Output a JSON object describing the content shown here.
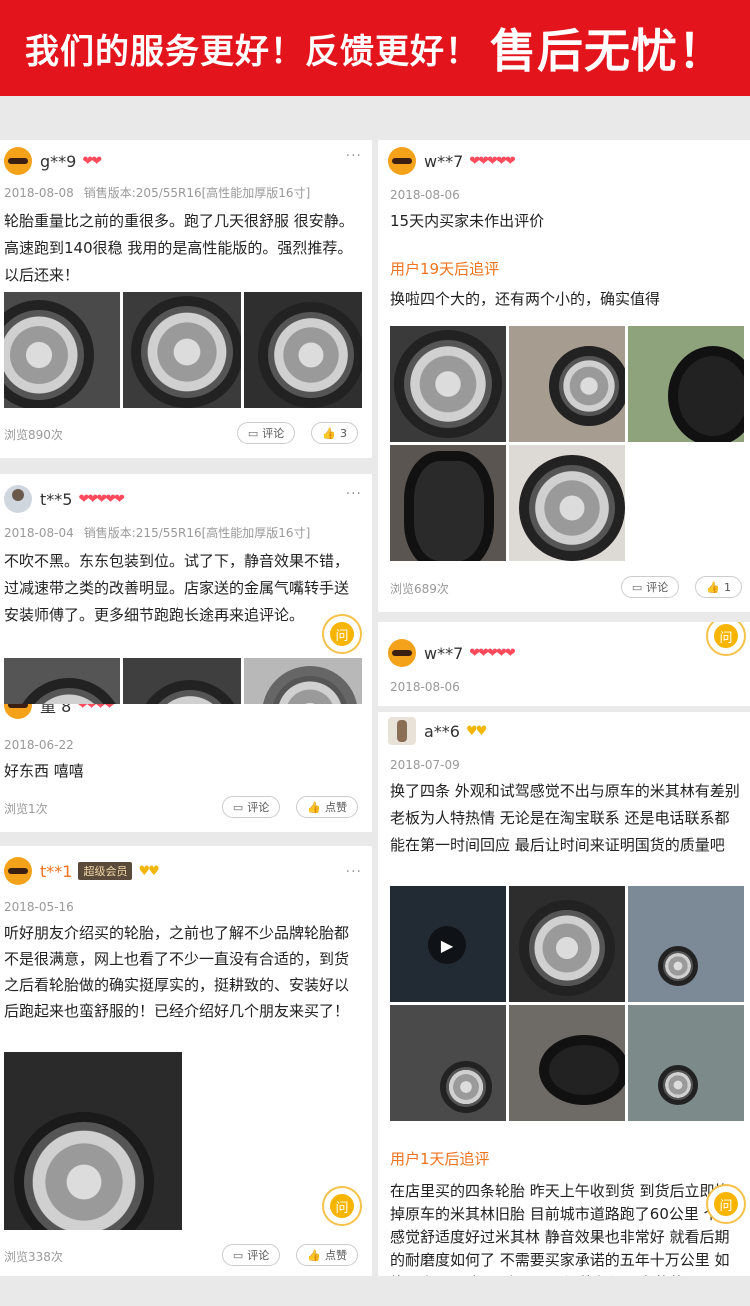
{
  "banner": {
    "text": "我们的服务更好！反馈更好！",
    "emphasis": "售后无忧！"
  },
  "reviews": [
    {
      "user": "g**9",
      "hearts": "❤❤",
      "date": "2018-08-08",
      "version": "销售版本:205/55R16[高性能加厚版16寸]",
      "text": "轮胎重量比之前的重很多。跑了几天很舒服 很安静。高速跑到140很稳 我用的是高性能版的。强烈推荐。以后还来！",
      "views": "浏览890次",
      "comment": "评论",
      "likes": "3"
    },
    {
      "user": "t**5",
      "hearts": "❤❤❤❤❤",
      "date": "2018-08-04",
      "version": "销售版本:215/55R16[高性能加厚版16寸]",
      "text": "不吹不黑。东东包装到位。试了下，静音效果不错，过减速带之类的改善明显。店家送的金属气嘴转手送安装师傅了。更多细节跑跑长途再来追评论。"
    },
    {
      "user": "童 8",
      "hearts": "❤❤❤❤",
      "date": "2018-06-22",
      "text": "好东西  嘻嘻",
      "views": "浏览1次",
      "comment": "评论",
      "like": "点赞"
    },
    {
      "user": "t**1",
      "badge": "超级会员",
      "hearts": "♥♥",
      "date": "2018-05-16",
      "text": "听好朋友介绍买的轮胎，之前也了解不少品牌轮胎都不是很满意，网上也看了不少一直没有合适的，到货之后看轮胎做的确实挺厚实的，挺耕致的、安装好以后跑起来也蛮舒服的！已经介绍好几个朋友来买了！",
      "views": "浏览338次",
      "comment": "评论",
      "like": "点赞"
    },
    {
      "user": "w**7",
      "hearts": "❤❤❤❤❤",
      "date": "2018-08-06",
      "text": "15天内买家未作出评价",
      "followup_label": "用户19天后追评",
      "followup_text": "换啦四个大的，还有两个小的，确实值得",
      "views": "浏览689次",
      "comment": "评论",
      "likes": "1"
    },
    {
      "user": "w**7",
      "hearts": "❤❤❤❤❤",
      "date": "2018-08-06"
    },
    {
      "user": "a**6",
      "hearts": "♥♥",
      "date": "2018-07-09",
      "text": "换了四条 外观和试驾感觉不出与原车的米其林有差别 老板为人特热情 无论是在淘宝联系 还是电话联系都能在第一时间回应 最后让时间来证明国货的质量吧",
      "followup_label": "用户1天后追评",
      "followup_text": "在店里买的四条轮胎 昨天上午收到货 到货后立即换掉原车的米其林旧胎 目前城市道路跑了60公里 个人感觉舒适度好过米其林 静音效果也非常好 就看后期的耐磨度如何了 不需要买家承诺的五年十万公里 如能用上四 五年五 六万公里还能保证现有的状况"
    }
  ],
  "more_icon": "···",
  "ask_label": "问"
}
